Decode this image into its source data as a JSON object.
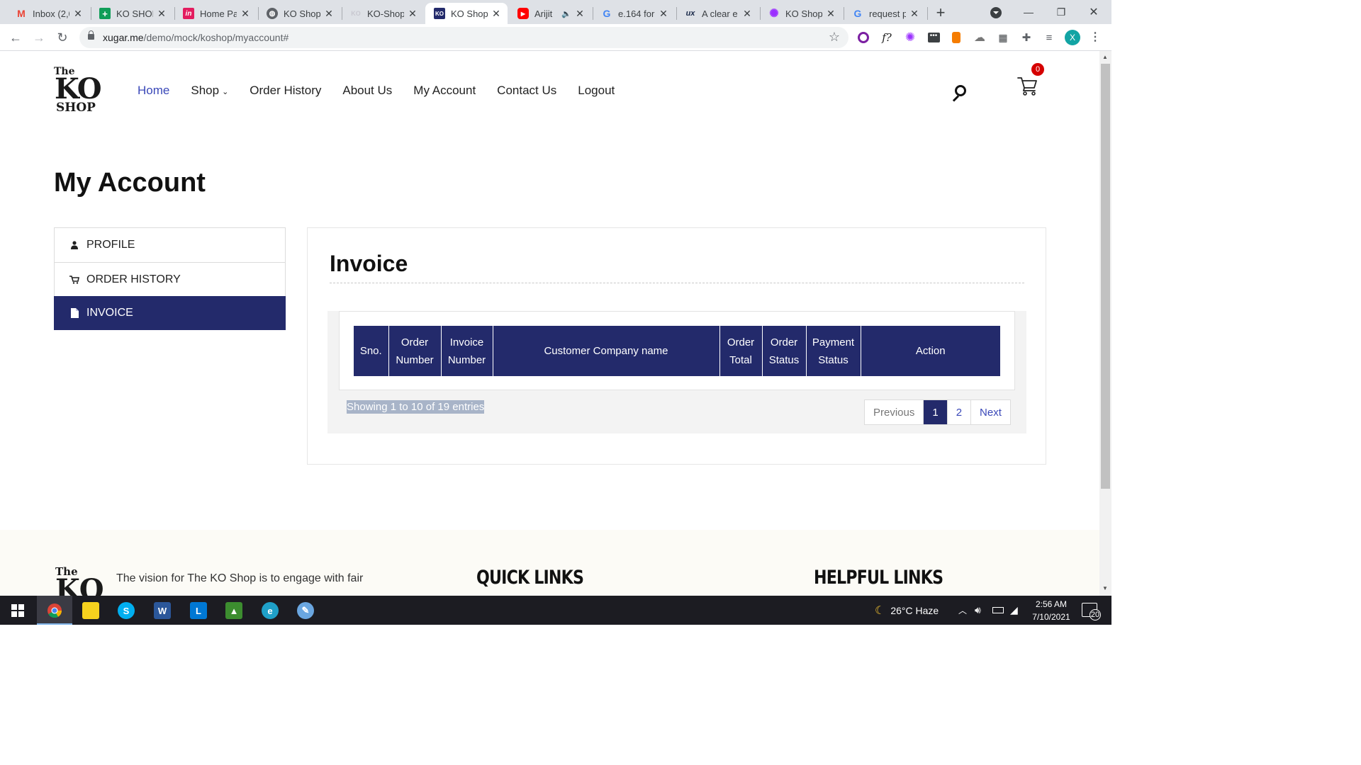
{
  "browser": {
    "tabs": [
      {
        "title": "Inbox (2,0",
        "favicon": "gmail-icon",
        "color": "#ea4335",
        "glyph": "M"
      },
      {
        "title": "KO SHOP",
        "favicon": "sheets-icon",
        "color": "#0f9d58",
        "glyph": "+"
      },
      {
        "title": "Home Pa",
        "favicon": "invision-icon",
        "color": "#e31c5f",
        "glyph": "in"
      },
      {
        "title": "KO Shop",
        "favicon": "globe-icon",
        "color": "#5f6368",
        "glyph": "◍"
      },
      {
        "title": "KO-Shop",
        "favicon": "ko-shop-icon",
        "color": "#c8c8d0",
        "glyph": "KO"
      },
      {
        "title": "KO Shop",
        "favicon": "ko-shop-icon",
        "color": "#232a6b",
        "glyph": "KO"
      },
      {
        "title": "Arijit",
        "favicon": "youtube-icon",
        "color": "#ff0000",
        "glyph": "▶"
      },
      {
        "title": "e.164 for",
        "favicon": "google-icon",
        "color": "#4285f4",
        "glyph": "G"
      },
      {
        "title": "A clear e",
        "favicon": "ux-icon",
        "color": "#1b2a4a",
        "glyph": "ux"
      },
      {
        "title": "KO Shop",
        "favicon": "flower-icon",
        "color": "#9b30ff",
        "glyph": "✺"
      },
      {
        "title": "request p",
        "favicon": "google-icon",
        "color": "#4285f4",
        "glyph": "G"
      }
    ],
    "url_host": "xugar.me",
    "url_path": "/demo/mock/koshop/myaccount#",
    "profile_initial": "X"
  },
  "site": {
    "logo": {
      "the": "The",
      "ko": "KO",
      "shop": "SHOP"
    },
    "nav": [
      {
        "label": "Home"
      },
      {
        "label": "Shop"
      },
      {
        "label": "Order History"
      },
      {
        "label": "About Us"
      },
      {
        "label": "My Account"
      },
      {
        "label": "Contact Us"
      },
      {
        "label": "Logout"
      }
    ],
    "cart_count": "0"
  },
  "page": {
    "title": "My Account",
    "sidebar": [
      {
        "label": "PROFILE",
        "icon": "user-icon"
      },
      {
        "label": "ORDER HISTORY",
        "icon": "cart-icon"
      },
      {
        "label": "INVOICE",
        "icon": "document-icon",
        "active": true
      }
    ],
    "invoice": {
      "heading": "Invoice",
      "columns": [
        [
          "Sno."
        ],
        [
          "Order",
          "Number"
        ],
        [
          "Invoice",
          "Number"
        ],
        [
          "Customer Company name"
        ],
        [
          "Order",
          "Total"
        ],
        [
          "Order",
          "Status"
        ],
        [
          "Payment",
          "Status"
        ],
        [
          "Action"
        ]
      ],
      "showing": "Showing 1 to 10 of 19 entries",
      "pagination": {
        "previous": "Previous",
        "pages": [
          "1",
          "2"
        ],
        "current": "1",
        "next": "Next"
      }
    }
  },
  "footer": {
    "logo": {
      "the": "The",
      "ko": "KO"
    },
    "vision": "The vision for The KO Shop is to engage with fair",
    "quick_links": "QUICK LINKS",
    "helpful_links": "HELPFUL LINKS"
  },
  "taskbar": {
    "weather": "26°C  Haze",
    "time": "2:56 AM",
    "date": "7/10/2021",
    "notifications": "20"
  },
  "colors": {
    "brand_navy": "#232a6b",
    "link_blue": "#3a48b8",
    "badge_red": "#d50000"
  }
}
